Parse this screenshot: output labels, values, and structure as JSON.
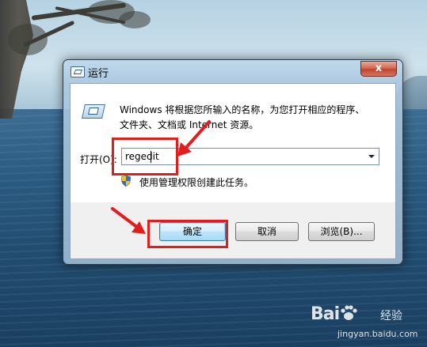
{
  "dialog": {
    "title": "运行",
    "close_glyph": "x",
    "description_line1": "Windows 将根据您所输入的名称，为您打开相应的程序、",
    "description_line2": "文件夹、文档或 Internet 资源。",
    "open_label": "打开(O):",
    "input_value": "regedit",
    "admin_note": "使用管理权限创建此任务。",
    "ok_label": "确定",
    "cancel_label": "取消",
    "browse_label": "浏览(B)..."
  },
  "watermark": {
    "logo_text": "Bai",
    "logo_suffix": "经验",
    "url": "jingyan.baidu.com"
  },
  "colors": {
    "highlight": "#e21d1d",
    "ok_border": "#3c7fb1"
  },
  "icons": [
    "run-icon",
    "shield-icon",
    "close-icon",
    "dropdown-arrow-icon",
    "paw-icon"
  ]
}
